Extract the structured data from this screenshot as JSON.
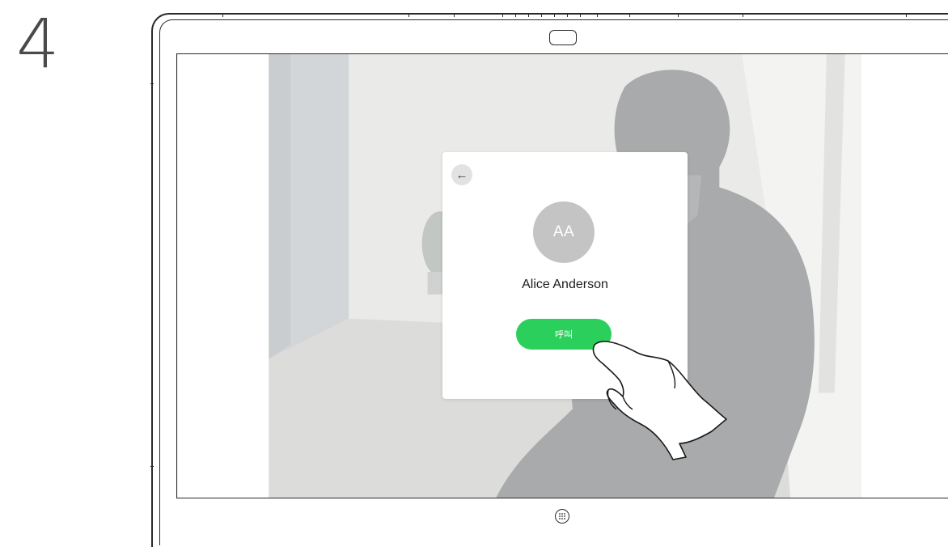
{
  "step": {
    "number": "4"
  },
  "device": {
    "camera_icon": "camera-icon",
    "home_icon": "home-grid-icon"
  },
  "call_card": {
    "back_icon": "back-arrow-icon",
    "back_glyph": "←",
    "avatar_initials": "AA",
    "contact_name": "Alice Anderson",
    "call_button_label": "呼叫"
  },
  "colors": {
    "call_button": "#2bd05c",
    "avatar": "#c4c4c4",
    "screen_background": "#e9e9e7"
  },
  "overlay": {
    "gesture_icon": "pointing-hand-icon"
  }
}
